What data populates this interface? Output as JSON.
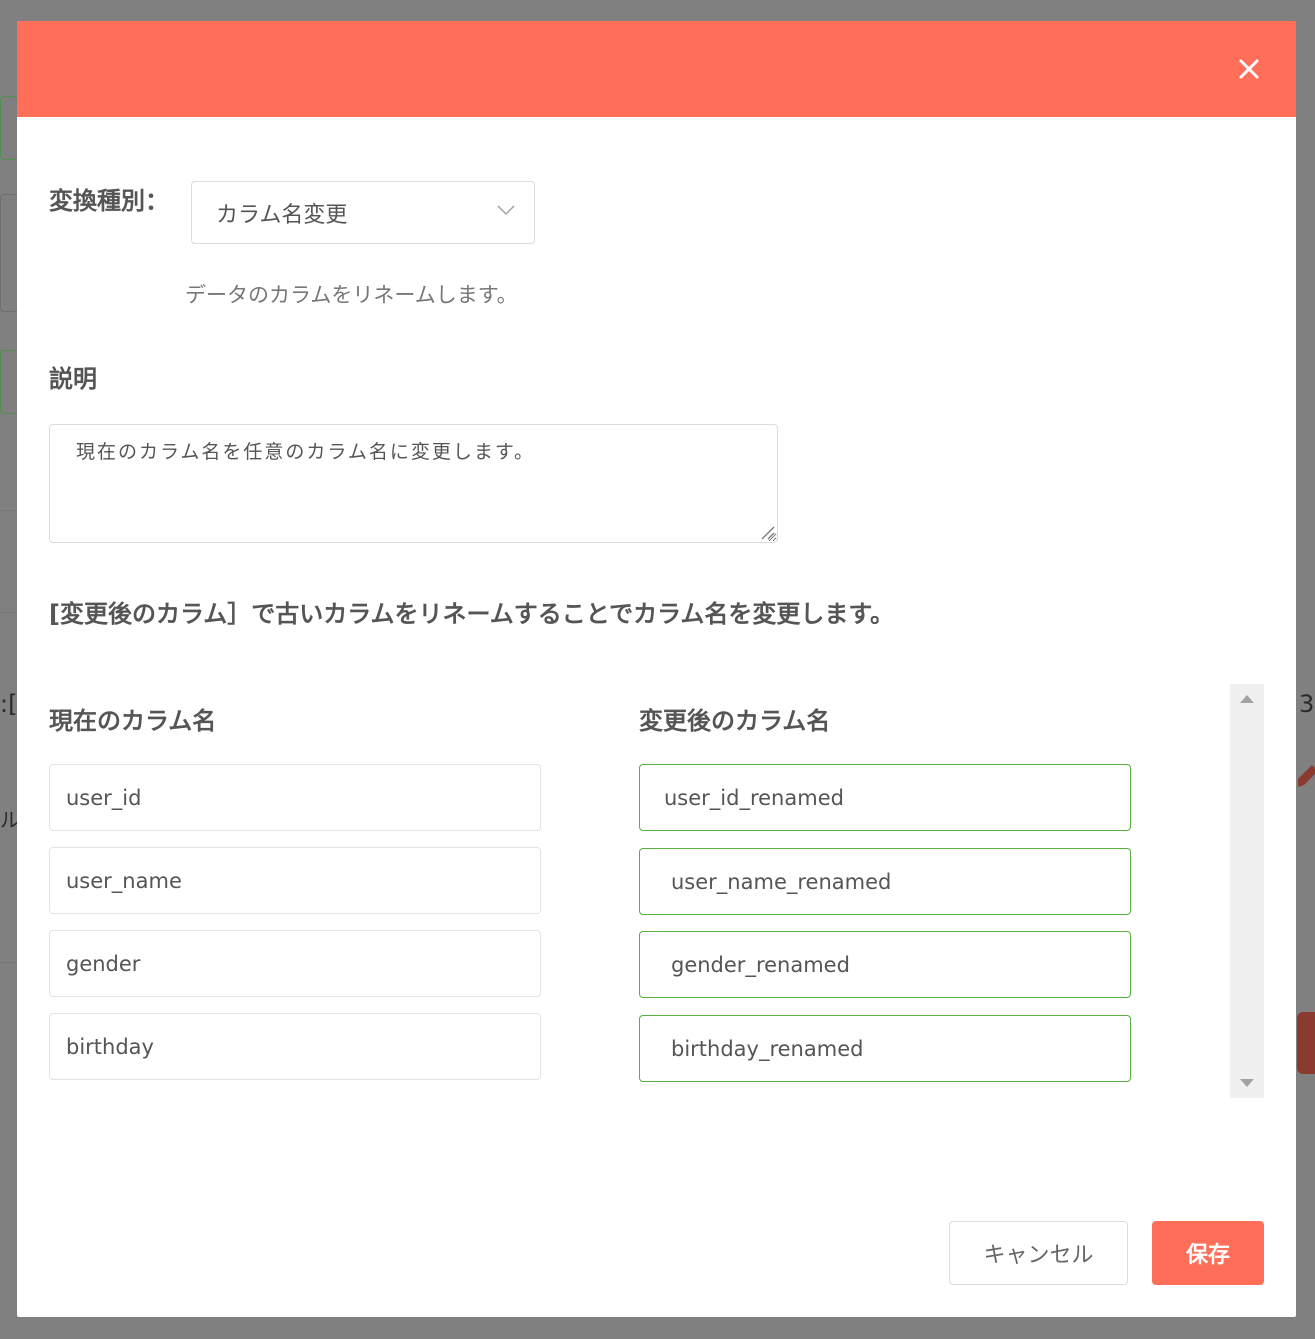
{
  "colors": {
    "header": "#ff6e59",
    "accent": "#ff6e59",
    "valid_border": "#58b040",
    "overlay": "#808080"
  },
  "background": {
    "fragments": [
      ":[",
      "3",
      "ル"
    ]
  },
  "header": {
    "close_icon": "close-icon"
  },
  "conversion": {
    "label": "変換種別：",
    "selected": "カラム名変更",
    "description": "データのカラムをリネームします。"
  },
  "description": {
    "label": "説明",
    "value": "現在のカラム名を任意のカラム名に変更します。"
  },
  "instruction": "[変更後のカラム］で古いカラムをリネームすることでカラム名を変更します。",
  "columns": {
    "current_header": "現在のカラム名",
    "renamed_header": "変更後のカラム名",
    "rows": [
      {
        "current": "user_id",
        "renamed": "user_id_renamed"
      },
      {
        "current": "user_name",
        "renamed": "user_name_renamed"
      },
      {
        "current": "gender",
        "renamed": "gender_renamed"
      },
      {
        "current": "birthday",
        "renamed": "birthday_renamed"
      }
    ]
  },
  "footer": {
    "cancel_label": "キャンセル",
    "save_label": "保存"
  }
}
